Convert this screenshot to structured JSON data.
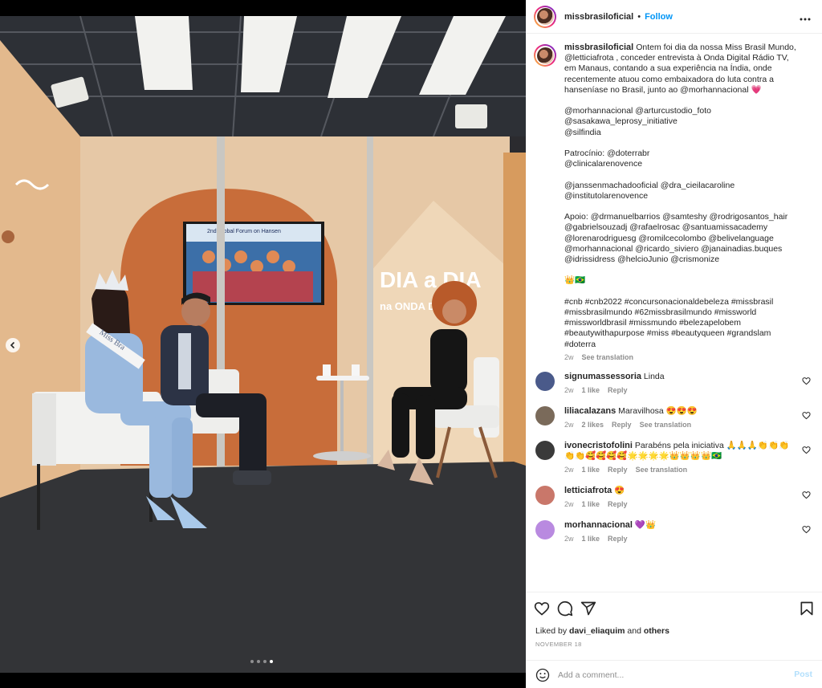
{
  "post": {
    "username": "missbrasiloficial",
    "follow_label": "Follow",
    "more_label": "•••",
    "separator": "•"
  },
  "media": {
    "tv_screen_text": "2nd Global Forum on Hansen",
    "wall_logo_main": "DIA a DIA",
    "wall_logo_sub": "na ONDA D",
    "sash_text": "Miss Bra",
    "carousel_dots": 4,
    "active_dot": 4
  },
  "caption": {
    "username": "missbrasiloficial",
    "text": "Ontem foi dia da nossa Miss Brasil Mundo, @letticiafrota , conceder entrevista à Onda Digital Rádio TV, em Manaus, contando a sua experiência na Índia, onde recentemente atuou como embaixadora do luta contra a hanseníase no Brasil, junto ao @morhannacional 💗\n\n@morhannacional @arturcustodio_foto\n@sasakawa_leprosy_initiative\n@silfindia\n\nPatrocínio: @doterrabr\n@clinicalarenovence\n\n@janssenmachadooficial @dra_cieilacaroline\n@institutolarenovence\n\nApoio: @drmanuelbarrios @samteshy @rodrigosantos_hair\n@gabrielsouzadj @rafaelrosac @santuamissacademy\n@lorenarodriguesg @romilcecolombo @belivelanguage\n@morhannacional @ricardo_siviero @janainadias.buques\n@idrissidress @helcioJunio @crismonize\n\n👑🇧🇷\n\n#cnb #cnb2022 #concursonacionaldebeleza #missbrasil\n#missbrasilmundo #62missbrasilmundo #missworld\n#missworldbrasil #missmundo #belezapelobem\n#beautywithapurpose #miss #beautyqueen #grandslam\n#doterra",
    "time": "2w",
    "see_translation": "See translation"
  },
  "comments": [
    {
      "username": "signumassessoria",
      "text": "Linda",
      "time": "2w",
      "likes": "1 like",
      "reply": "Reply",
      "translation": "",
      "avatar_color": "#4a5a8a"
    },
    {
      "username": "liliacalazans",
      "text": "Maravilhosa 😍😍😍",
      "time": "2w",
      "likes": "2 likes",
      "reply": "Reply",
      "translation": "See translation",
      "avatar_color": "#7a6a5a"
    },
    {
      "username": "ivonecristofolini",
      "text": "Parabéns pela iniciativa 🙏🙏🙏👏👏👏👏👏🥰🥰🥰🥰🌟🌟🌟🌟👑👑👑👑🇧🇷",
      "time": "2w",
      "likes": "1 like",
      "reply": "Reply",
      "translation": "See translation",
      "avatar_color": "#3a3a3a"
    },
    {
      "username": "letticiafrota",
      "text": "😍",
      "time": "2w",
      "likes": "1 like",
      "reply": "Reply",
      "translation": "",
      "avatar_color": "#c9776a"
    },
    {
      "username": "morhannacional",
      "text": "💜👑",
      "time": "2w",
      "likes": "1 like",
      "reply": "Reply",
      "translation": "",
      "avatar_color": "#b98ae0"
    }
  ],
  "footer": {
    "liked_by_prefix": "Liked by ",
    "liked_by_user": "davi_eliaquim",
    "liked_by_and": " and ",
    "liked_by_others": "others",
    "date": "NOVEMBER 18",
    "add_comment_placeholder": "Add a comment...",
    "post_label": "Post"
  },
  "colors": {
    "accent": "#0095f6",
    "post_disabled": "#b2dffc",
    "meta": "#8e8e8e"
  },
  "icons": [
    "more-icon",
    "heart-icon",
    "comment-icon",
    "share-icon",
    "bookmark-icon",
    "emoji-icon",
    "chevron-left-icon"
  ]
}
